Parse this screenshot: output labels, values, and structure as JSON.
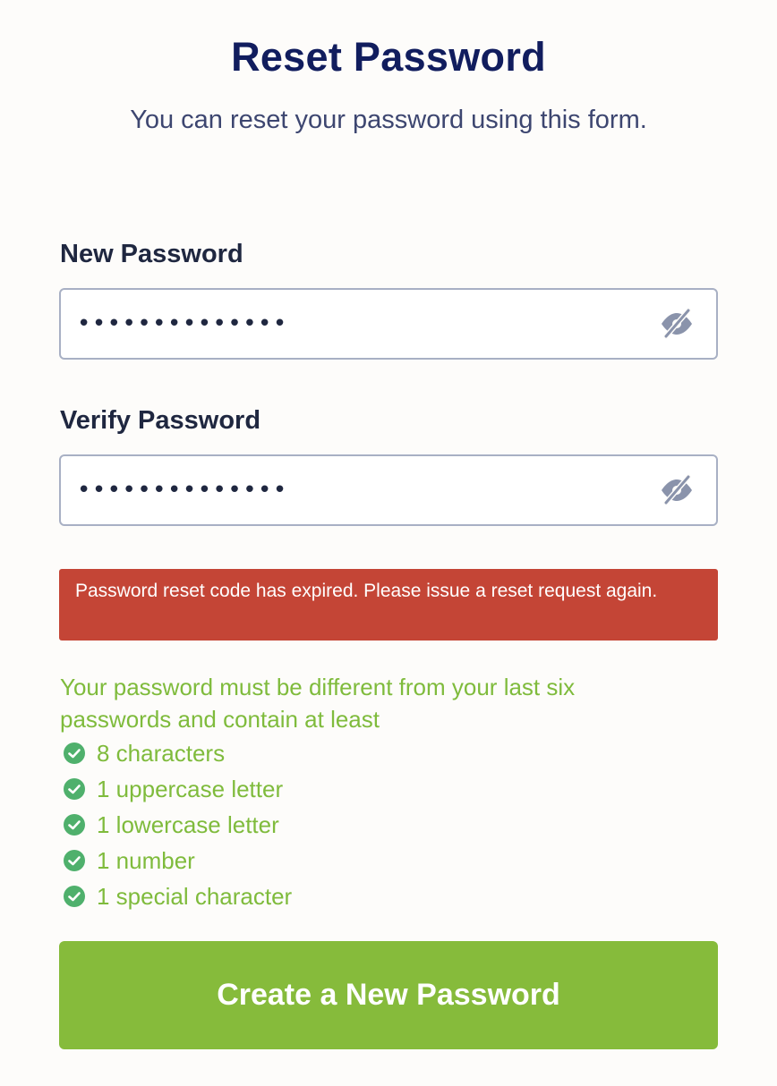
{
  "header": {
    "title": "Reset Password",
    "subtitle": "You can reset your password using this form."
  },
  "form": {
    "new_password": {
      "label": "New Password",
      "value": "••••••••••••••",
      "toggle_icon": "eye-slash-icon"
    },
    "verify_password": {
      "label": "Verify Password",
      "value": "••••••••••••••",
      "toggle_icon": "eye-slash-icon"
    }
  },
  "error": {
    "message": "Password reset code has expired. Please issue a reset request again.",
    "color": "#c44536"
  },
  "requirements": {
    "intro": "Your password must be different from your last six passwords and contain at least",
    "items": [
      {
        "label": "8 characters",
        "icon": "check-circle-icon",
        "met": true
      },
      {
        "label": "1 uppercase letter",
        "icon": "check-circle-icon",
        "met": true
      },
      {
        "label": "1 lowercase letter",
        "icon": "check-circle-icon",
        "met": true
      },
      {
        "label": "1 number",
        "icon": "check-circle-icon",
        "met": true
      },
      {
        "label": "1 special character",
        "icon": "check-circle-icon",
        "met": true
      }
    ],
    "color": "#7fbb3c"
  },
  "submit": {
    "label": "Create a New Password",
    "color": "#86bb3b"
  },
  "colors": {
    "title": "#111d5e",
    "background": "#fdfcfa"
  }
}
